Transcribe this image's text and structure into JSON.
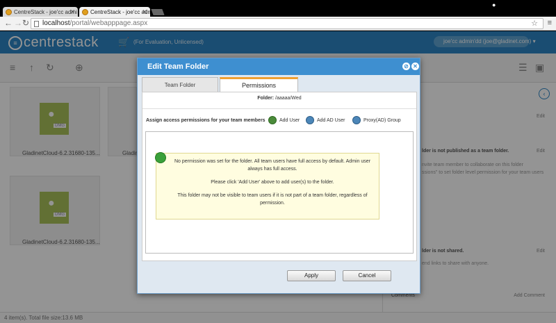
{
  "browser": {
    "tabs": [
      {
        "title": "CentreStack - joe'cc admi",
        "active": false
      },
      {
        "title": "CentreStack - joe'cc admi",
        "active": true
      }
    ],
    "url_host": "localhost",
    "url_path": "/portal/webapppage.aspx"
  },
  "app": {
    "brand": "centrestack",
    "eval_note": "(For Evaluation, Unlicensed)",
    "user_pill": "joe'cc admin'dd (joe@gladinet.com) ▾",
    "accent": "#2e86c4"
  },
  "files": [
    {
      "name": "GladinetCloud-6.2.31680-135...",
      "badge": "DMG"
    },
    {
      "name": "Gladine",
      "badge": "DMG"
    },
    {
      "name": "GladinetCloud-6.2.31680-135...",
      "badge": "DMG"
    }
  ],
  "right_panel": {
    "edit": "Edit",
    "not_published": "lder is not published as a team folder.",
    "team_hint_1": "nvite team member to collaborate on this folder",
    "team_hint_2": "ssions\" to set folder level permission for your team users",
    "not_shared": "lder is not shared.",
    "share_hint": "end links to share with anyone.",
    "comments": "Comments",
    "add_comment": "Add Comment"
  },
  "status": {
    "summary": "4 item(s). Total file size:13.6 MB"
  },
  "dialog": {
    "title": "Edit Team Folder",
    "tabs": {
      "team_folder": "Team Folder",
      "permissions": "Permissions"
    },
    "folder_label": "Folder:",
    "folder_value": "/aaaaa/Wed",
    "assign_label": "Assign access permissions for your team members",
    "actions": {
      "add_user": "Add User",
      "add_ad_user": "Add AD User",
      "proxy_group": "Proxy(AD) Group"
    },
    "notice": {
      "line1": "No permission was set for the folder. All team users have full access by default. Admin user always has full access.",
      "line2": "Please click 'Add User' above to add user(s) to the folder.",
      "line3": "This folder may not be visible to team users if it is not part of a team folder, regardless of permission."
    },
    "buttons": {
      "apply": "Apply",
      "cancel": "Cancel"
    }
  }
}
